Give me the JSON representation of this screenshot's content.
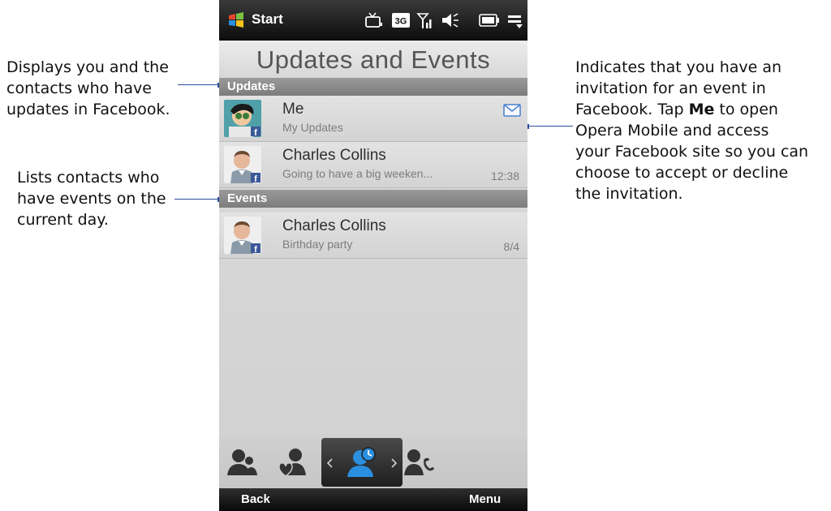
{
  "callouts": {
    "left1": [
      "Displays you and the",
      "contacts who have",
      "updates in Facebook."
    ],
    "left2": [
      "Lists contacts who",
      "have events on the",
      "current day."
    ],
    "right": {
      "line1": "Indicates that you have an",
      "line2": "invitation for an event in",
      "line3": "Facebook. Tap ",
      "line3_bold": "Me",
      "line3_rest": " to open",
      "line4": "Opera Mobile and access",
      "line5": "your Facebook site so you can",
      "line6": "choose to accept or decline",
      "line7": "the invitation."
    }
  },
  "status_bar": {
    "start_label": "Start",
    "icons": [
      "windows-logo-icon",
      "tv-icon",
      "3g-icon",
      "signal-icon",
      "volume-icon",
      "battery-icon",
      "connection-icon"
    ],
    "network_label": "3G"
  },
  "title": "Updates and Events",
  "updates": {
    "header": "Updates",
    "items": [
      {
        "name": "Me",
        "subtitle": "My Updates",
        "time": "",
        "icon": "envelope-icon"
      },
      {
        "name": "Charles Collins",
        "subtitle": "Going to have a big weeken...",
        "time": "12:38"
      }
    ]
  },
  "events": {
    "header": "Events",
    "items": [
      {
        "name": "Charles Collins",
        "subtitle": "Birthday party",
        "time": "8/4"
      }
    ]
  },
  "tabs": [
    "people-icon",
    "favorite-people-icon",
    "updates-events-icon",
    "call-history-icon"
  ],
  "softkeys": {
    "left": "Back",
    "right": "Menu"
  },
  "colors": {
    "leader": "#2a4e9c",
    "section_header": "#8a8a8a",
    "accent_blue": "#2b8fe0"
  }
}
